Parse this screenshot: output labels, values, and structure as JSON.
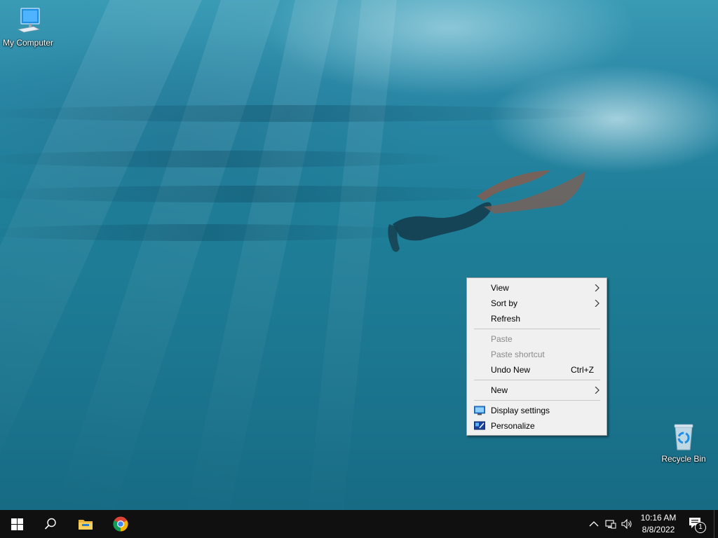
{
  "desktop": {
    "icons": [
      {
        "label": "My Computer",
        "icon": "computer-icon"
      },
      {
        "label": "Recycle Bin",
        "icon": "recycle-bin-icon"
      }
    ]
  },
  "context_menu": {
    "items": [
      {
        "label": "View",
        "submenu": true,
        "enabled": true
      },
      {
        "label": "Sort by",
        "submenu": true,
        "enabled": true
      },
      {
        "label": "Refresh",
        "enabled": true
      },
      {
        "label": "Paste",
        "enabled": false
      },
      {
        "label": "Paste shortcut",
        "enabled": false
      },
      {
        "label": "Undo New",
        "shortcut": "Ctrl+Z",
        "enabled": true
      },
      {
        "label": "New",
        "submenu": true,
        "enabled": true
      },
      {
        "label": "Display settings",
        "icon": "display-settings-icon",
        "enabled": true
      },
      {
        "label": "Personalize",
        "icon": "personalize-icon",
        "enabled": true
      }
    ]
  },
  "taskbar": {
    "buttons": [
      {
        "icon": "windows-start-icon"
      },
      {
        "icon": "search-icon"
      },
      {
        "icon": "file-explorer-icon"
      },
      {
        "icon": "chrome-icon"
      }
    ],
    "tray": {
      "icons": [
        "chevron-up-icon",
        "network-icon",
        "volume-icon"
      ],
      "time": "10:16 AM",
      "date": "8/8/2022",
      "notification_count": "1"
    }
  },
  "colors": {
    "taskbar": "#101010",
    "menu_background": "#f0f0f0",
    "menu_disabled_text": "#8a8a8a",
    "ocean": "#1f7f99"
  }
}
